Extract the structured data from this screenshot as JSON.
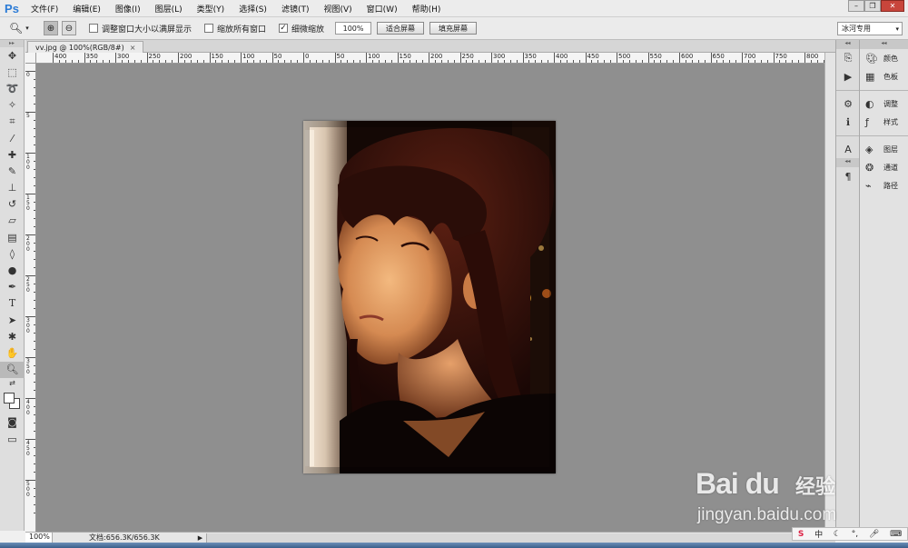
{
  "app": {
    "logo": "Ps"
  },
  "menu": [
    "文件(F)",
    "编辑(E)",
    "图像(I)",
    "图层(L)",
    "类型(Y)",
    "选择(S)",
    "滤镜(T)",
    "视图(V)",
    "窗口(W)",
    "帮助(H)"
  ],
  "options": {
    "resize_windows": "调整窗口大小以满屏显示",
    "zoom_all_windows": "缩放所有窗口",
    "scrubby_zoom": "细微缩放",
    "zoom_value": "100%",
    "fit_screen": "适合屏幕",
    "fill_screen": "填充屏幕",
    "checks": {
      "resize_windows": false,
      "zoom_all_windows": false,
      "scrubby_zoom": true
    }
  },
  "workspace": "冰河专用",
  "document": {
    "tab_title": "vv.jpg @ 100%(RGB/8#)",
    "close": "×"
  },
  "ruler_top": [
    "400",
    "350",
    "300",
    "250",
    "200",
    "150",
    "100",
    "50",
    "0",
    "50",
    "100",
    "150",
    "200",
    "250",
    "300",
    "350",
    "400",
    "450",
    "500",
    "550",
    "600",
    "650",
    "700",
    "750",
    "800"
  ],
  "ruler_left": [
    "0",
    "5",
    "1 0 0",
    "1 5 0",
    "2 0 0",
    "2 5 0",
    "3 0 0",
    "3 5 0",
    "4 0 0",
    "4 5 0",
    "5 0 0"
  ],
  "status": {
    "zoom": "100%",
    "doc_info": "文档:656.3K/656.3K"
  },
  "right_panels": [
    {
      "icon": "color-palette-icon",
      "label": "颜色"
    },
    {
      "icon": "swatches-icon",
      "label": "色板"
    },
    {
      "icon": "adjustments-icon",
      "label": "调整"
    },
    {
      "icon": "styles-icon",
      "label": "样式"
    },
    {
      "icon": "layers-icon",
      "label": "图层"
    },
    {
      "icon": "channels-icon",
      "label": "通道"
    },
    {
      "icon": "paths-icon",
      "label": "路径"
    }
  ],
  "watermark": {
    "brand": "Bai du",
    "suffix": "经验",
    "url": "jingyan.baidu.com"
  },
  "ime": {
    "s": "S",
    "mode": "中"
  },
  "colors": {
    "canvas_bg": "#8f8f8f",
    "logo": "#2b7bd6"
  }
}
